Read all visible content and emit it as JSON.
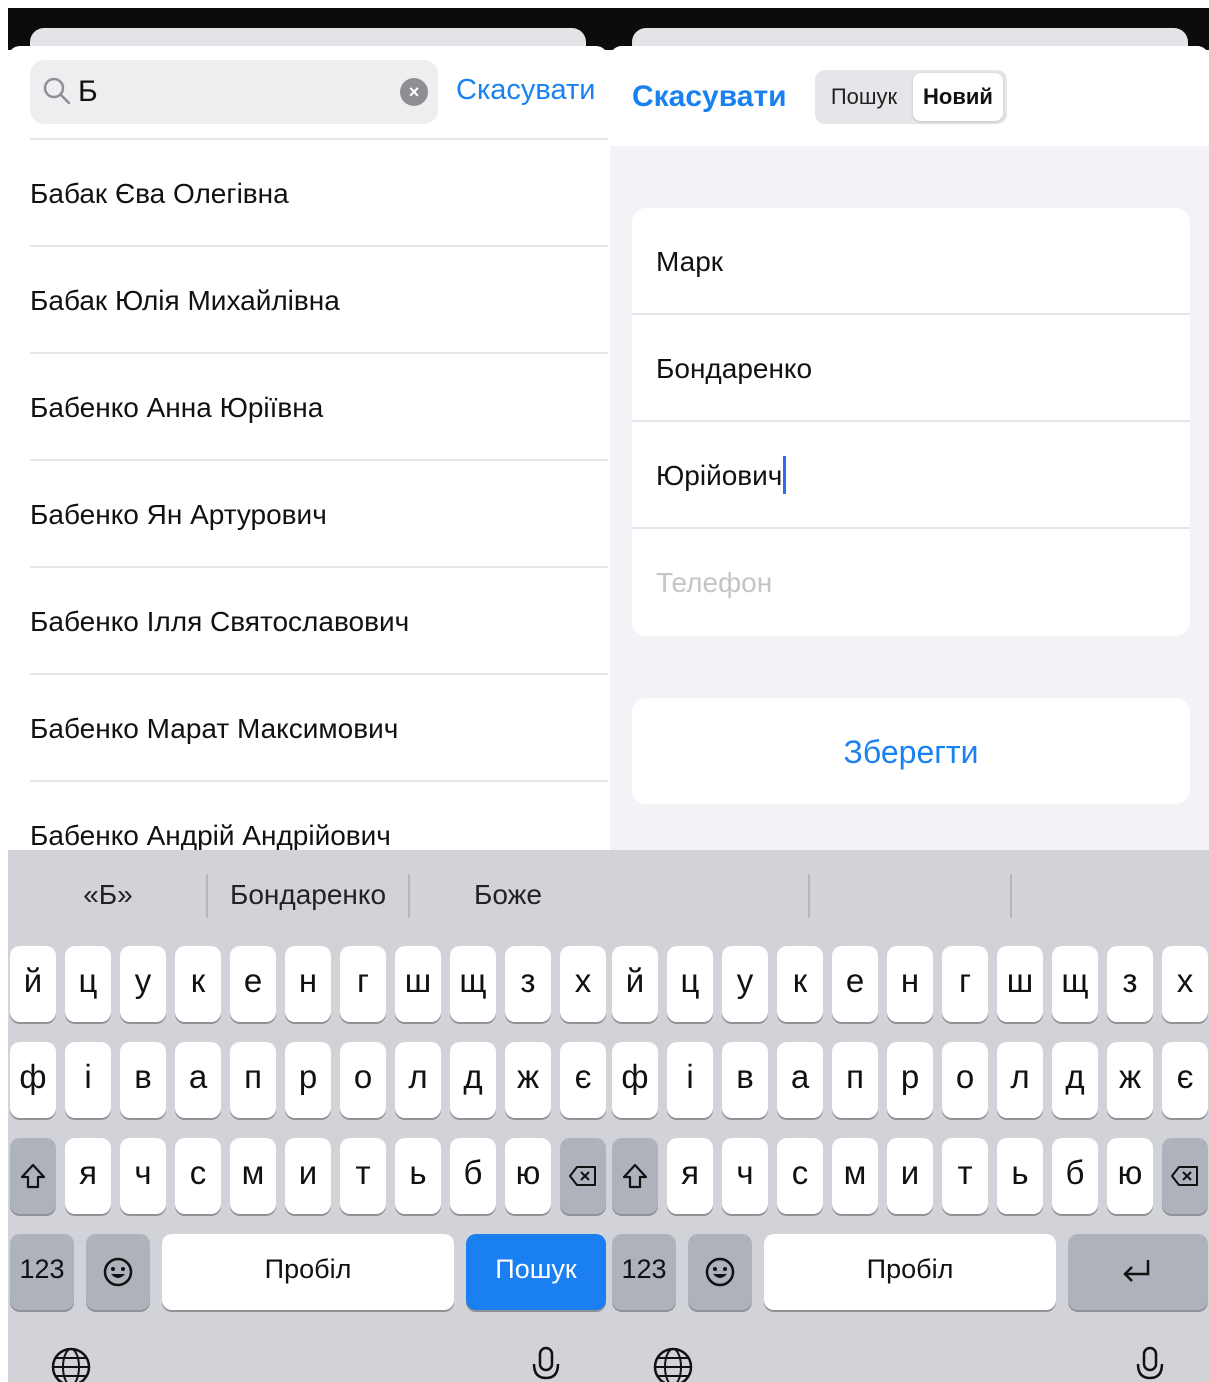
{
  "left": {
    "search": {
      "value": "Б",
      "cancel_label": "Скасувати"
    },
    "results": [
      "Бабак Єва Олегівна",
      "Бабак Юлія Михайлівна",
      "Бабенко Анна Юріївна",
      "Бабенко Ян Артурович",
      "Бабенко Ілля Святославович",
      "Бабенко Марат Максимович",
      "Бабенко Андрій Андрійович"
    ]
  },
  "right": {
    "cancel_label": "Скасувати",
    "segments": {
      "search": "Пошук",
      "new": "Новий",
      "selected": "Новий"
    },
    "form": {
      "first_name": "Марк",
      "last_name": "Бондаренко",
      "patronymic": "Юрійович",
      "phone_placeholder": "Телефон"
    },
    "save_label": "Зберегти"
  },
  "keyboard": {
    "suggestions": [
      "«Б»",
      "Бондаренко",
      "Боже"
    ],
    "row1": [
      "й",
      "ц",
      "у",
      "к",
      "е",
      "н",
      "г",
      "ш",
      "щ",
      "з",
      "х"
    ],
    "row2": [
      "ф",
      "і",
      "в",
      "а",
      "п",
      "р",
      "о",
      "л",
      "д",
      "ж",
      "є"
    ],
    "row3": [
      "я",
      "ч",
      "с",
      "м",
      "и",
      "т",
      "ь",
      "б",
      "ю"
    ],
    "numbers_label": "123",
    "space_label": "Пробіл",
    "left_action_label": "Пошук",
    "colors": {
      "accent": "#1a82f0",
      "keyboard_bg": "#d1d3d9",
      "key_dark": "#aeb2bb"
    }
  }
}
